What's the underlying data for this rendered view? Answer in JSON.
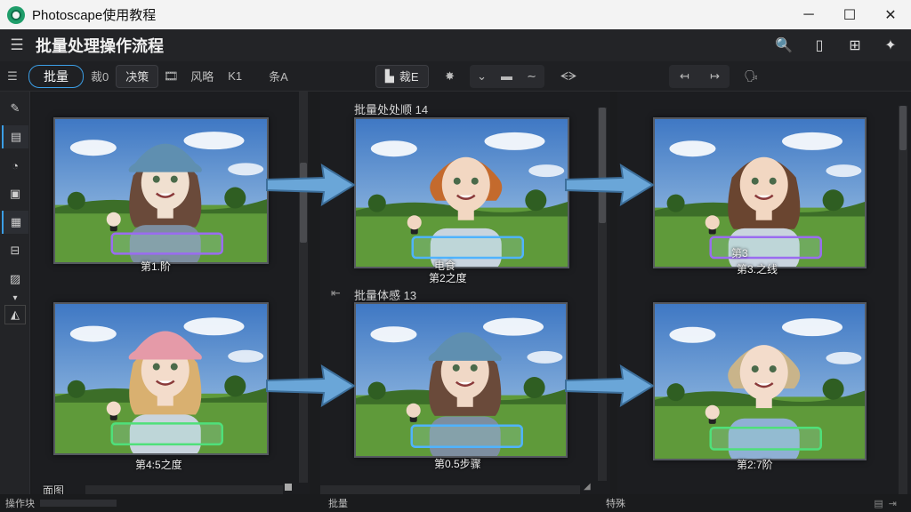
{
  "window": {
    "title": "Photoscape使用教程",
    "min": "─",
    "max": "☐",
    "close": "✕"
  },
  "header": {
    "menu": "☰",
    "title": "批量处理操作流程",
    "icons": [
      "search-icon",
      "phone-icon",
      "grid-icon",
      "pin-icon"
    ],
    "icon_glyphs": [
      "🔍",
      "▯",
      "⊞",
      "✦"
    ]
  },
  "toolbar": {
    "menu": "☰",
    "batch_label": "批量",
    "item1": "裁0",
    "item2": "决策",
    "item3": "风略",
    "item4": "K1",
    "item5": "条А",
    "box_label": "裁E",
    "item6": "ᗕᗒ",
    "right_icons": [
      "↤",
      "↦",
      "🗣"
    ]
  },
  "sidebar": {
    "items": [
      "✎",
      "▤",
      "◔",
      "▣",
      "▦",
      "⊟",
      "▨",
      "▾",
      "◭"
    ]
  },
  "columns": {
    "col1": {
      "caption_top": "第1.阶",
      "caption_bottom": "第4:5之度",
      "footer": "面图"
    },
    "col2": {
      "label_top": "批量处处顺 14",
      "label_bottom": "批量体感 13",
      "caption_top_a": "电食",
      "caption_top_b": "第2之度",
      "caption_bottom": "第0.5步骤",
      "footer": "批量"
    },
    "col3": {
      "caption_top_a": "第3",
      "caption_top_b": "第3.之线",
      "caption_bottom": "第2:7阶",
      "footer": "特殊"
    }
  },
  "status": {
    "left": "操作块"
  },
  "colors": {
    "accent": "#3b9ee6",
    "arrow": "#6aa6d8",
    "glow_blue": "#4fb3ff",
    "glow_purple": "#9a6cf0",
    "glow_green": "#4fe07a"
  }
}
